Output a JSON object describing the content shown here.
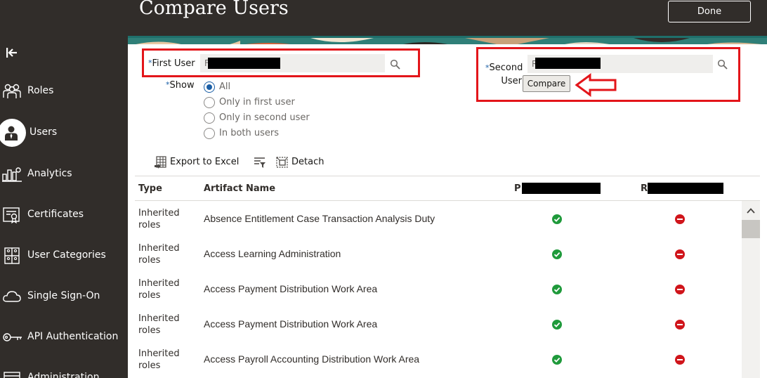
{
  "header": {
    "title": "Compare Users",
    "done_label": "Done"
  },
  "sidebar": {
    "items": [
      {
        "label": "Roles",
        "icon": "roles-icon"
      },
      {
        "label": "Users",
        "icon": "user-icon",
        "active": true
      },
      {
        "label": "Analytics",
        "icon": "analytics-icon"
      },
      {
        "label": "Certificates",
        "icon": "certificate-icon"
      },
      {
        "label": "User Categories",
        "icon": "user-categories-icon"
      },
      {
        "label": "Single Sign-On",
        "icon": "cloud-icon"
      },
      {
        "label": "API Authentication",
        "icon": "key-icon"
      },
      {
        "label": "Administration",
        "icon": "administration-icon"
      }
    ]
  },
  "form": {
    "required_marker": "*",
    "first_user_label": "First User",
    "first_user_value": "F",
    "second_user_label_line1": "Second",
    "second_user_label_line2": "User",
    "second_user_value": "R",
    "show_label": "Show",
    "show_options": [
      "All",
      "Only in first user",
      "Only in second user",
      "In both users"
    ],
    "show_selected": "All",
    "compare_label": "Compare"
  },
  "toolbar": {
    "export_label": "Export to Excel",
    "detach_label": "Detach"
  },
  "table": {
    "columns": {
      "type": "Type",
      "artifact": "Artifact Name",
      "first_user": "P",
      "second_user": "R"
    },
    "rows": [
      {
        "type": "Inherited roles",
        "name": "Absence Entitlement Case Transaction Analysis Duty",
        "in_first": true,
        "in_second": false
      },
      {
        "type": "Inherited roles",
        "name": "Access Learning Administration",
        "in_first": true,
        "in_second": false
      },
      {
        "type": "Inherited roles",
        "name": "Access Payment Distribution Work Area",
        "in_first": true,
        "in_second": false
      },
      {
        "type": "Inherited roles",
        "name": "Access Payment Distribution Work Area",
        "in_first": true,
        "in_second": false
      },
      {
        "type": "Inherited roles",
        "name": "Access Payroll Accounting Distribution Work Area",
        "in_first": true,
        "in_second": false
      }
    ]
  },
  "colors": {
    "header_bg": "#312d2a",
    "accent": "#1b5fa6",
    "highlight": "#e3151a",
    "ok": "#1f9a3b",
    "no": "#d0151b"
  }
}
